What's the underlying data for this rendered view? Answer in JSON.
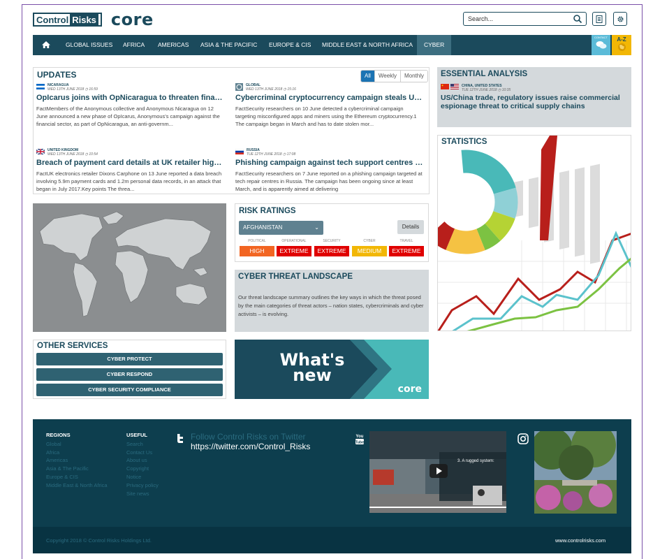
{
  "brand": {
    "logo_control": "Control",
    "logo_risks": "Risks",
    "product": "core"
  },
  "search": {
    "placeholder": "Search..."
  },
  "nav": {
    "items": [
      "GLOBAL ISSUES",
      "AFRICA",
      "AMERICAS",
      "ASIA & THE PACIFIC",
      "EUROPE & CIS",
      "MIDDLE EAST & NORTH AFRICA",
      "CYBER"
    ],
    "active": "CYBER"
  },
  "contact": {
    "label": "CONTACT"
  },
  "az": {
    "label": "A-Z"
  },
  "updates": {
    "title": "UPDATES",
    "tabs": [
      "All",
      "Weekly",
      "Monthly"
    ],
    "active_tab": "All",
    "stories": [
      {
        "region": "NICARAGUA",
        "date": "WED 13TH JUNE 2018",
        "time": "16:59",
        "headline": "OpIcarus joins with OpNicaragua to threaten financi...",
        "body": "FactMembers of the Anonymous collective and Anonymous Nicaragua on 12 June announced a new phase of OpIcarus, Anonymous's campaign against the financial sector, as part of OpNicaragua, an anti-governm..."
      },
      {
        "region": "GLOBAL",
        "date": "WED 13TH JUNE 2018",
        "time": "15:16",
        "headline": "Cybercriminal cryptocurrency campaign steals USD 2...",
        "body": "FactSecurity researchers on 10 June detected a cybercriminal campaign targeting misconfigured apps and miners using the Ethereum cryptocurrency.1 The campaign began in March and has to date stolen mor..."
      },
      {
        "region": "UNITED KINGDOM",
        "date": "WED 13TH JUNE 2018",
        "time": "10:54",
        "headline": "Breach of payment card details at UK retailer highlig...",
        "body": "FactUK electronics retailer Dixons Carphone on 13 June reported a data breach involving 5.9m payment cards and 1.2m personal data records, in an attack that began in July 2017.Key points The threa..."
      },
      {
        "region": "RUSSIA",
        "date": "TUE 12TH JUNE 2018",
        "time": "17:08",
        "headline": "Phishing campaign against tech support centres sug...",
        "body": "FactSecurity researchers on 7 June reported on a phishing campaign targeted at tech repair centres in Russia. The campaign has been ongoing since at least March, and is apparently aimed at delivering"
      }
    ]
  },
  "essential": {
    "title": "ESSENTIAL ANALYSIS",
    "region": "CHINA, UNITED STATES",
    "date": "TUE 12TH JUNE 2018",
    "time": "10:35",
    "headline": "US/China trade, regulatory issues raise commercial espionage threat to critical supply chains"
  },
  "statistics": {
    "title": "STATISTICS"
  },
  "risk": {
    "title": "RISK RATINGS",
    "country": "AFGHANISTAN",
    "details_label": "Details",
    "ratings": [
      {
        "category": "POLITICAL",
        "value": "HIGH",
        "color": "#f26522"
      },
      {
        "category": "OPERATIONAL",
        "value": "EXTREME",
        "color": "#e00000"
      },
      {
        "category": "SECURITY",
        "value": "EXTREME",
        "color": "#e00000"
      },
      {
        "category": "CYBER",
        "value": "MEDIUM",
        "color": "#f2b705"
      },
      {
        "category": "TRAVEL",
        "value": "EXTREME",
        "color": "#e00000"
      }
    ]
  },
  "cyber_threat": {
    "title": "CYBER THREAT LANDSCAPE",
    "body": "Our threat landscape summary outlines the key ways in which the threat posed by the main categories of threat actors – nation states, cybercriminals and cyber activists – is evolving."
  },
  "other_services": {
    "title": "OTHER SERVICES",
    "items": [
      "CYBER PROTECT",
      "CYBER RESPOND",
      "CYBER SECURITY COMPLIANCE"
    ]
  },
  "whats_new": {
    "line1": "What's",
    "line2": "new",
    "brand": "core"
  },
  "footer": {
    "regions_title": "REGIONS",
    "regions": [
      "Global",
      "Africa",
      "Americas",
      "Asia & The Pacific",
      "Europe & CIS",
      "Middle East & North Africa"
    ],
    "useful_title": "USEFUL",
    "useful": [
      "Search",
      "Contact Us",
      "About us",
      "Copyright",
      "Notice",
      "Privacy policy",
      "Site news"
    ],
    "twitter_follow": "Follow Control Risks on Twitter",
    "twitter_url": "https://twitter.com/Control_Risks",
    "video_caption": "3. A rugged system:",
    "copyright": "Copyright 2018 © Control Risks Holdings Ltd.",
    "website": "www.controlrisks.com"
  },
  "colors": {
    "primary": "#1b4a5c",
    "footer": "#0d3e4e",
    "accent_teal": "#49b9b8",
    "az_yellow": "#f2b705",
    "contact_blue": "#5bbbd8"
  }
}
